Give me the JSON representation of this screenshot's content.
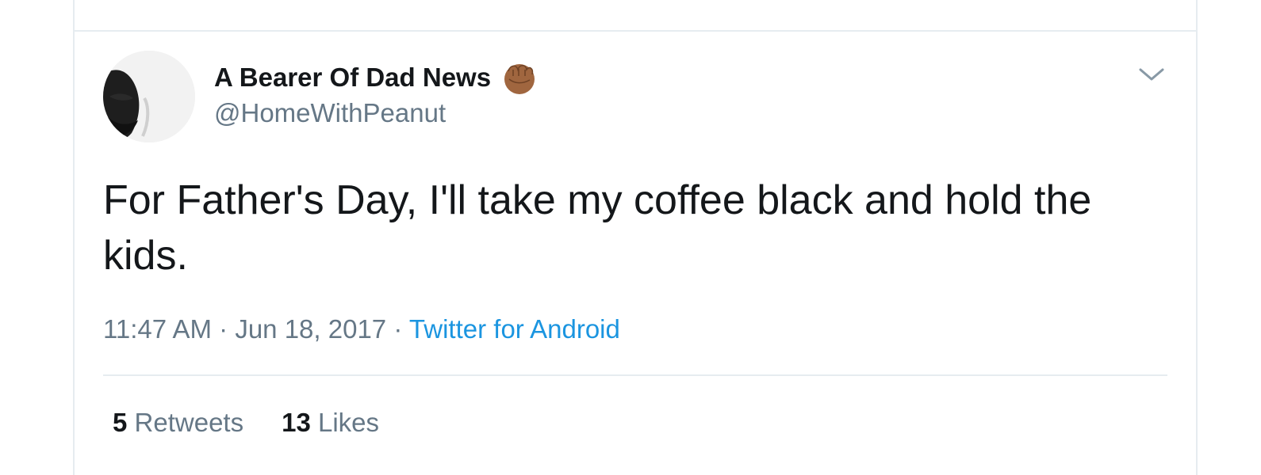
{
  "tweet": {
    "author": {
      "display_name": "A Bearer Of Dad News",
      "handle": "@HomeWithPeanut",
      "name_emoji_icon": "raised-fist-medium-dark-skin-icon",
      "avatar": "profile-photo"
    },
    "text": "For Father's Day, I'll take my coffee black and hold the kids.",
    "time": "11:47 AM",
    "date": "Jun 18, 2017",
    "separator": "·",
    "source": "Twitter for Android",
    "retweets_count": "5",
    "retweets_label": "Retweets",
    "likes_count": "13",
    "likes_label": "Likes",
    "menu_icon": "chevron-down-icon"
  },
  "colors": {
    "primary_text": "#14171a",
    "secondary_text": "#657786",
    "link": "#1b95e0",
    "divider": "#e6ecf0",
    "emoji_skin": "#a0663f"
  }
}
